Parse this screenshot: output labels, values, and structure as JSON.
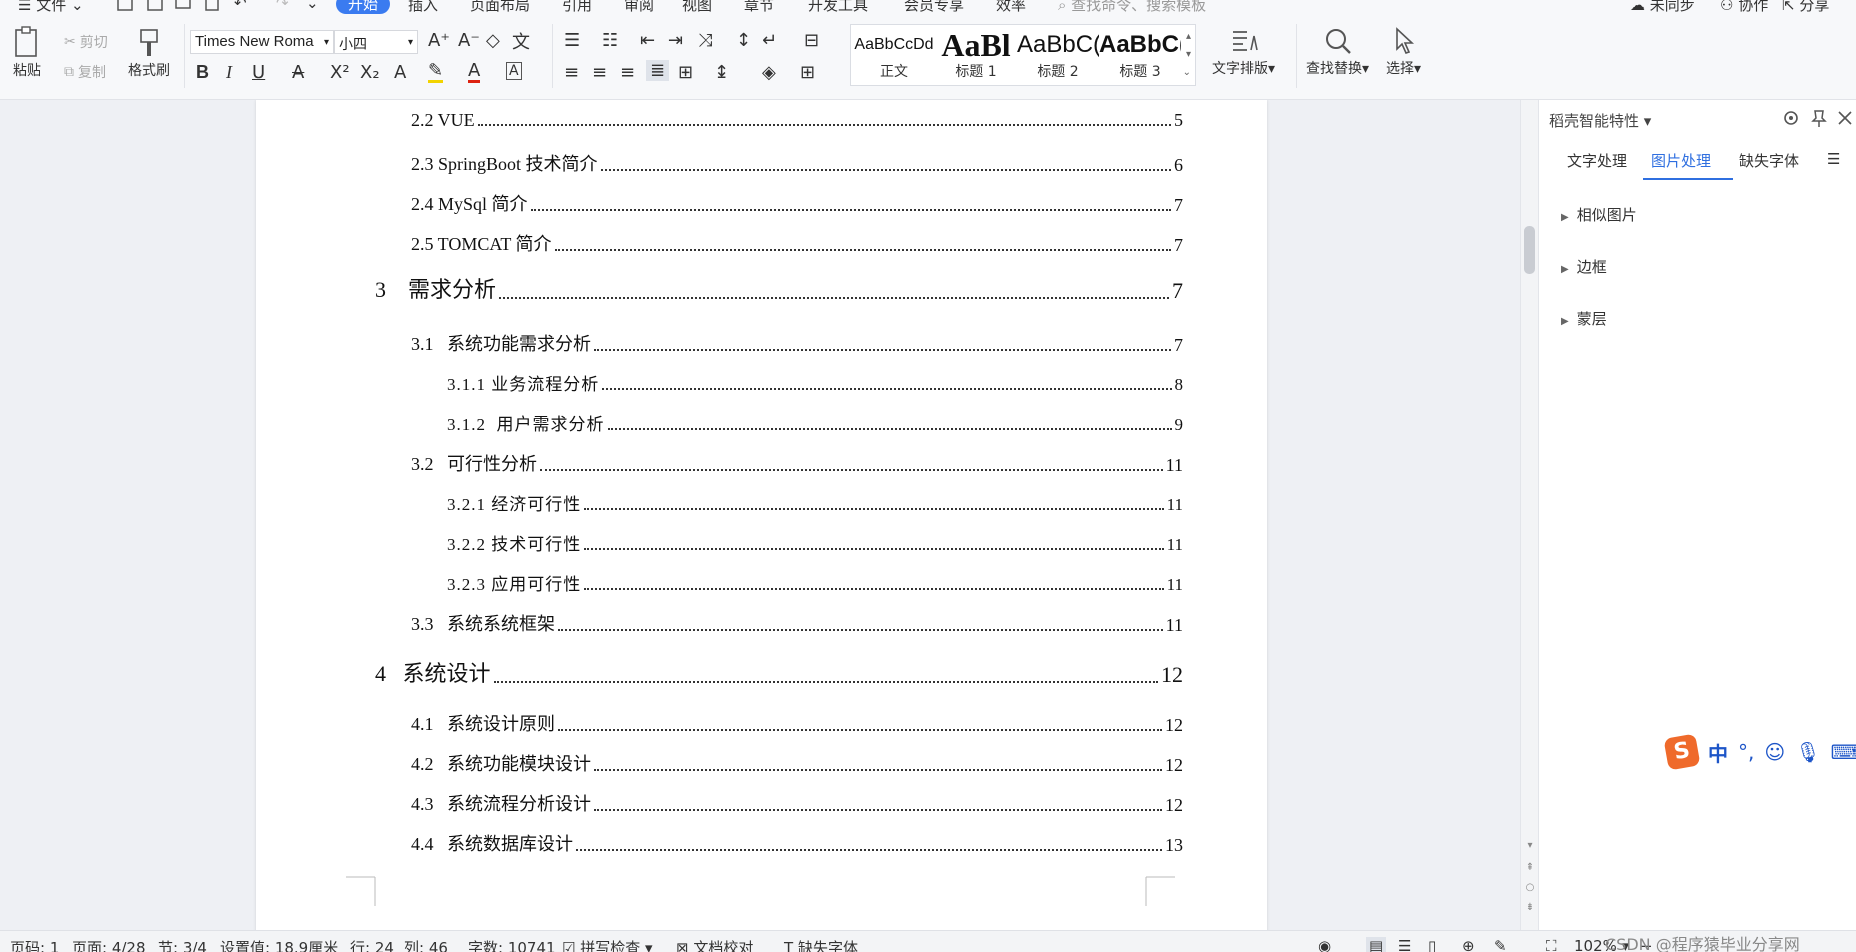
{
  "menubar": {
    "file_label": "文件",
    "tabs": [
      "开始",
      "插入",
      "页面布局",
      "引用",
      "审阅",
      "视图",
      "章节",
      "开发工具",
      "会员专享",
      "效率"
    ],
    "search_placeholder": "查找命令、搜索模板",
    "sync_label": "未同步",
    "collab_label": "协作",
    "share_label": "分享"
  },
  "ribbon": {
    "paste_label": "粘贴",
    "cut_label": "剪切",
    "copy_label": "复制",
    "format_painter_label": "格式刷",
    "font_name": "Times New Roma",
    "font_size": "小四",
    "styles": [
      {
        "sample": "AaBbCcDd",
        "name": "正文"
      },
      {
        "sample": "AaBl",
        "name": "标题 1"
      },
      {
        "sample": "AaBbC(",
        "name": "标题 2"
      },
      {
        "sample": "AaBbC(",
        "name": "标题 3"
      }
    ],
    "text_layout_label": "文字排版",
    "find_replace_label": "查找替换",
    "select_label": "选择",
    "accent_color": "#3a7bf0"
  },
  "toc": [
    {
      "text": "2.2 VUE",
      "page": "5"
    },
    {
      "text": "2.3 SpringBoot 技术简介",
      "page": "6"
    },
    {
      "text": "2.4 MySql 简介",
      "page": "7"
    },
    {
      "text": "2.5 TOMCAT 简介",
      "page": "7"
    },
    {
      "text": "3    需求分析",
      "page": "7"
    },
    {
      "text": "3.1   系统功能需求分析",
      "page": "7"
    },
    {
      "text": "3.1.1 业务流程分析",
      "page": "8"
    },
    {
      "text": "3.1.2  用户需求分析",
      "page": "9"
    },
    {
      "text": "3.2   可行性分析",
      "page": "11"
    },
    {
      "text": "3.2.1 经济可行性",
      "page": "11"
    },
    {
      "text": "3.2.2 技术可行性",
      "page": "11"
    },
    {
      "text": "3.2.3 应用可行性",
      "page": "11"
    },
    {
      "text": "3.3   系统系统框架",
      "page": "11"
    },
    {
      "text": "4   系统设计",
      "page": "12"
    },
    {
      "text": "4.1   系统设计原则",
      "page": "12"
    },
    {
      "text": "4.2   系统功能模块设计",
      "page": "12"
    },
    {
      "text": "4.3   系统流程分析设计",
      "page": "12"
    },
    {
      "text": "4.4   系统数据库设计",
      "page": "13"
    }
  ],
  "panel": {
    "title": "稻壳智能特性",
    "tabs": [
      "文字处理",
      "图片处理",
      "缺失字体"
    ],
    "active_tab": "图片处理",
    "sections": [
      "相似图片",
      "边框",
      "蒙层"
    ]
  },
  "statusbar": {
    "page_code": "页码: 1",
    "page": "页面: 4/28",
    "section": "节: 3/4",
    "setting": "设置值: 18.9厘米",
    "row": "行: 24",
    "col": "列: 46",
    "word_count": "字数: 10741",
    "spell_check": "拼写检查",
    "doc_proof": "文档校对",
    "missing_font": "缺失字体",
    "zoom": "102%",
    "watermark": "CSDN @程序猿毕业分享网"
  }
}
